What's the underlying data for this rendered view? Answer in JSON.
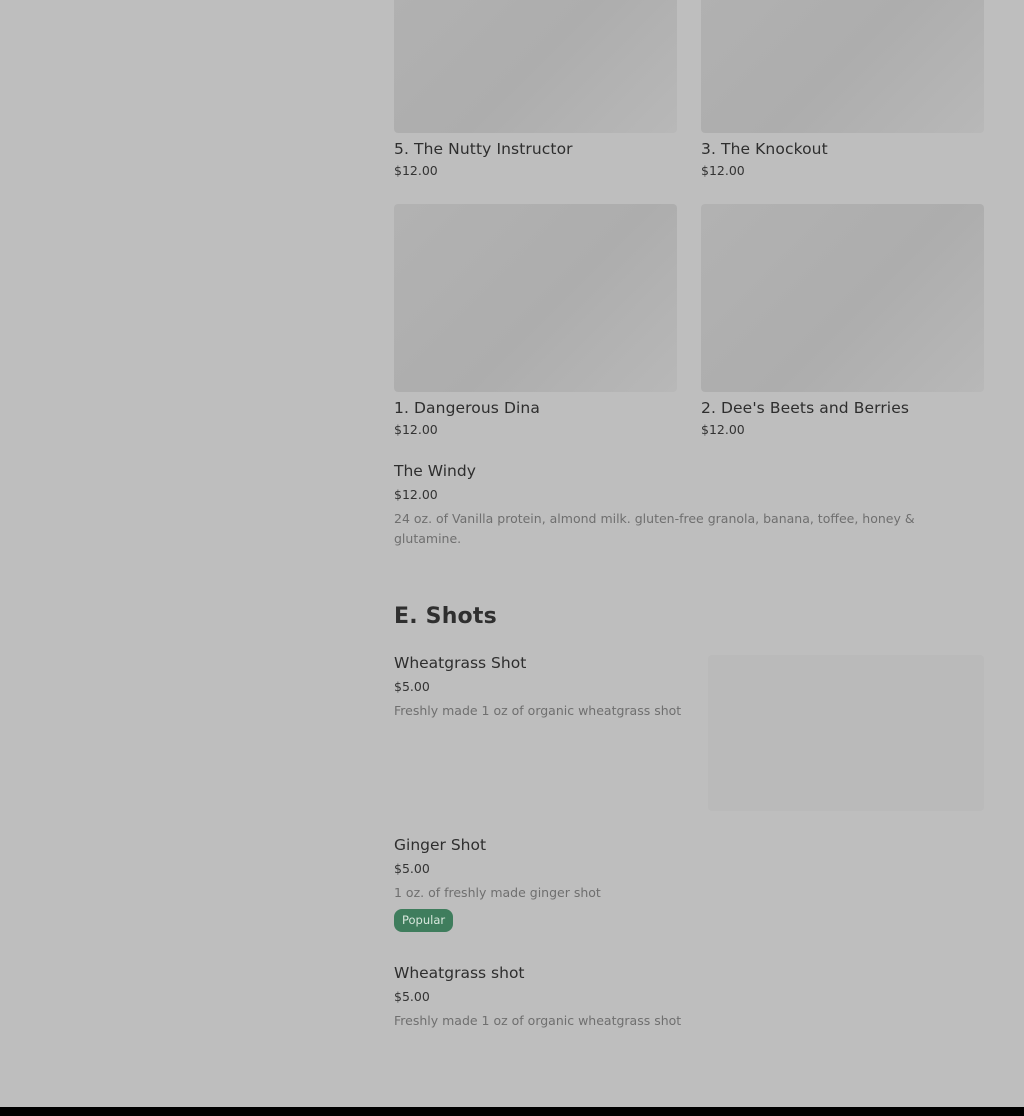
{
  "grid_items": [
    {
      "name": "5. The Nutty Instructor",
      "price": "$12.00"
    },
    {
      "name": "3. The Knockout",
      "price": "$12.00"
    },
    {
      "name": "1. Dangerous Dina",
      "price": "$12.00"
    },
    {
      "name": "2. Dee's Beets and Berries",
      "price": "$12.00"
    }
  ],
  "windy": {
    "name": "The Windy",
    "price": "$12.00",
    "description": "24 oz. of Vanilla protein, almond milk. gluten-free granola, banana, toffee, honey & glutamine."
  },
  "shots_section": {
    "title": "E. Shots",
    "items": [
      {
        "name": "Wheatgrass Shot",
        "price": "$5.00",
        "description": "Freshly made 1 oz of organic wheatgrass shot"
      },
      {
        "name": "Ginger Shot",
        "price": "$5.00",
        "description": "1 oz. of freshly made ginger shot",
        "badge": "Popular"
      },
      {
        "name": "Wheatgrass shot",
        "price": "$5.00",
        "description": "Freshly made 1 oz of organic wheatgrass shot"
      }
    ]
  },
  "colors": {
    "overlay_bg": "#bebebe",
    "badge_bg": "#3f7d5d"
  }
}
